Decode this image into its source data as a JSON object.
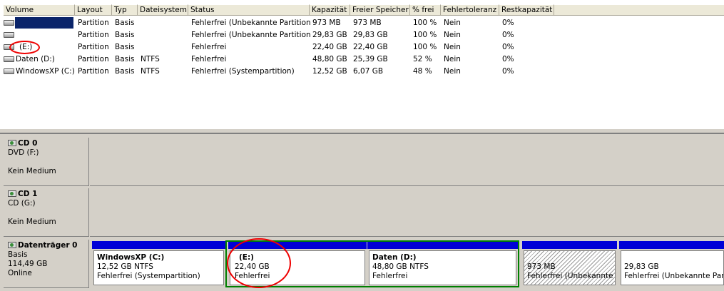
{
  "columns": [
    "Volume",
    "Layout",
    "Typ",
    "Dateisystem",
    "Status",
    "Kapazität",
    "Freier Speicher",
    "% frei",
    "Fehlertoleranz",
    "Restkapazität"
  ],
  "volumes": [
    {
      "volume": "",
      "layout": "Partition",
      "typ": "Basis",
      "fs": "",
      "status": "Fehlerfrei (Unbekannte Partition)",
      "kap": "973 MB",
      "frei": "973 MB",
      "pct": "100 %",
      "fehler": "Nein",
      "rest": "0%"
    },
    {
      "volume": "",
      "layout": "Partition",
      "typ": "Basis",
      "fs": "",
      "status": "Fehlerfrei (Unbekannte Partition)",
      "kap": "29,83 GB",
      "frei": "29,83 GB",
      "pct": "100 %",
      "fehler": "Nein",
      "rest": "0%"
    },
    {
      "volume": "(E:)",
      "layout": "Partition",
      "typ": "Basis",
      "fs": "",
      "status": "Fehlerfrei",
      "kap": "22,40 GB",
      "frei": "22,40 GB",
      "pct": "100 %",
      "fehler": "Nein",
      "rest": "0%"
    },
    {
      "volume": "Daten (D:)",
      "layout": "Partition",
      "typ": "Basis",
      "fs": "NTFS",
      "status": "Fehlerfrei",
      "kap": "48,80 GB",
      "frei": "25,39 GB",
      "pct": "52 %",
      "fehler": "Nein",
      "rest": "0%"
    },
    {
      "volume": "WindowsXP (C:)",
      "layout": "Partition",
      "typ": "Basis",
      "fs": "NTFS",
      "status": "Fehlerfrei (Systempartition)",
      "kap": "12,52 GB",
      "frei": "6,07 GB",
      "pct": "48 %",
      "fehler": "Nein",
      "rest": "0%"
    }
  ],
  "disks": [
    {
      "name": "CD 0",
      "l1": "DVD (F:)",
      "l2": "",
      "l3": "Kein Medium"
    },
    {
      "name": "CD 1",
      "l1": "CD (G:)",
      "l2": "",
      "l3": "Kein Medium"
    },
    {
      "name": "Datenträger 0",
      "l1": "Basis",
      "l2": "114,49 GB",
      "l3": "Online"
    }
  ],
  "partitions": [
    {
      "name": "WindowsXP  (C:)",
      "size": "12,52 GB NTFS",
      "status": "Fehlerfrei (Systempartition)"
    },
    {
      "name": "(E:)",
      "size": "22,40 GB",
      "status": "Fehlerfrei"
    },
    {
      "name": "Daten  (D:)",
      "size": "48,80 GB NTFS",
      "status": "Fehlerfrei"
    },
    {
      "name": "",
      "size": "973 MB",
      "status": "Fehlerfrei (Unbekannte P"
    },
    {
      "name": "",
      "size": "29,83 GB",
      "status": "Fehlerfrei (Unbekannte Partiti"
    }
  ],
  "colors": {
    "partition_bar": "#0000d7",
    "selection": "#0a246a",
    "highlight_ring": "#e00000",
    "highlight_box": "#008000"
  }
}
